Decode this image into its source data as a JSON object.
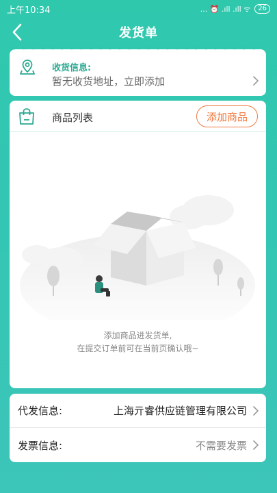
{
  "status_bar": {
    "time": "上午10:34",
    "indicators": "... ⏰ .ıll .ıll ᯤ",
    "battery": "26"
  },
  "header": {
    "title": "发货单",
    "back_icon": "chevron-left-icon"
  },
  "address": {
    "label": "收货信息:",
    "value": "暂无收货地址，立即添加",
    "icon": "location-pin-icon"
  },
  "goods": {
    "title": "商品列表",
    "add_button": "添加商品",
    "icon": "shopping-bag-icon",
    "empty_line1": "添加商品进发货单,",
    "empty_line2": "在提交订单前可在当前页确认哦~"
  },
  "info": {
    "agent_label": "代发信息:",
    "agent_value": "上海亓睿供应链管理有限公司",
    "invoice_label": "发票信息:",
    "invoice_value": "不需要发票"
  },
  "colors": {
    "primary": "#31c7ae",
    "accent_orange": "#f07a3e",
    "teal_text": "#2aa891"
  }
}
